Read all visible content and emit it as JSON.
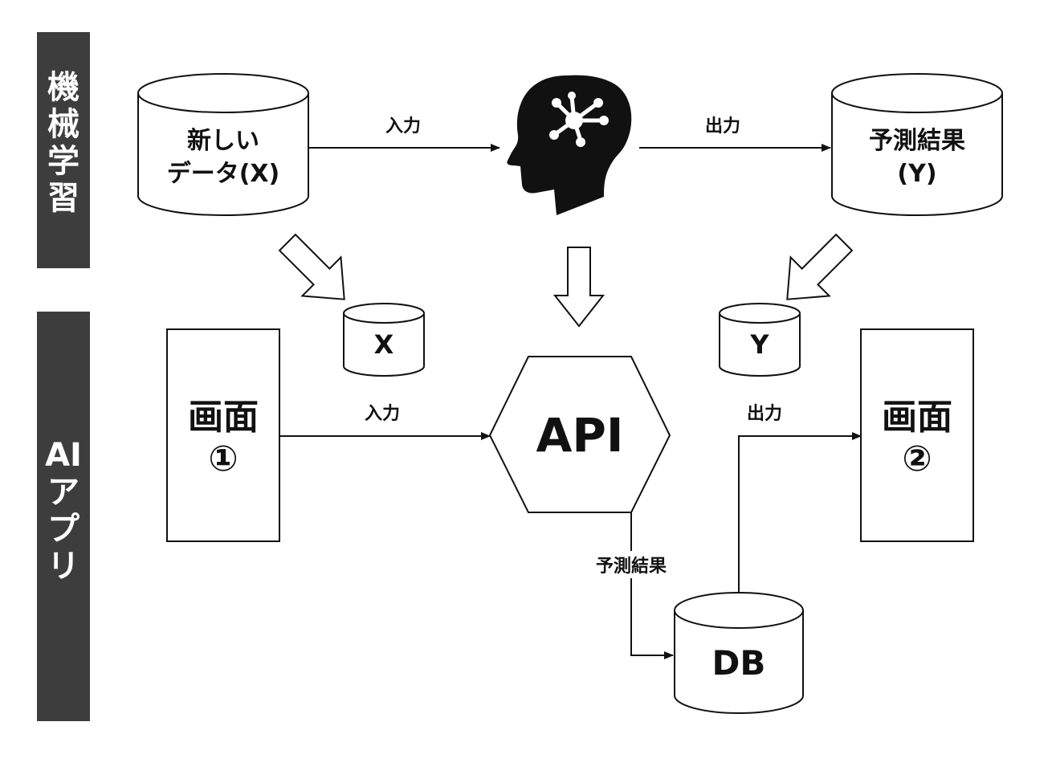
{
  "sections": {
    "ml": {
      "chars": [
        "機",
        "械",
        "学",
        "習"
      ]
    },
    "app": {
      "chars": [
        "AI",
        "ア",
        "プ",
        "リ"
      ]
    }
  },
  "ml_row": {
    "input_db": {
      "line1": "新しい",
      "line2": "データ(X)"
    },
    "input_edge_label": "入力",
    "brain_icon": "brain-network-icon",
    "output_edge_label": "出力",
    "output_db": {
      "line1": "予測結果",
      "line2": "(Y)"
    }
  },
  "app_row": {
    "x_db_label": "X",
    "y_db_label": "Y",
    "screen1": {
      "line1": "画面",
      "line2": "①"
    },
    "screen1_edge_label": "入力",
    "api_label": "API",
    "screen2_edge_label": "出力",
    "screen2": {
      "line1": "画面",
      "line2": "②"
    },
    "db_edge_label": "予測結果",
    "db_label": "DB"
  }
}
